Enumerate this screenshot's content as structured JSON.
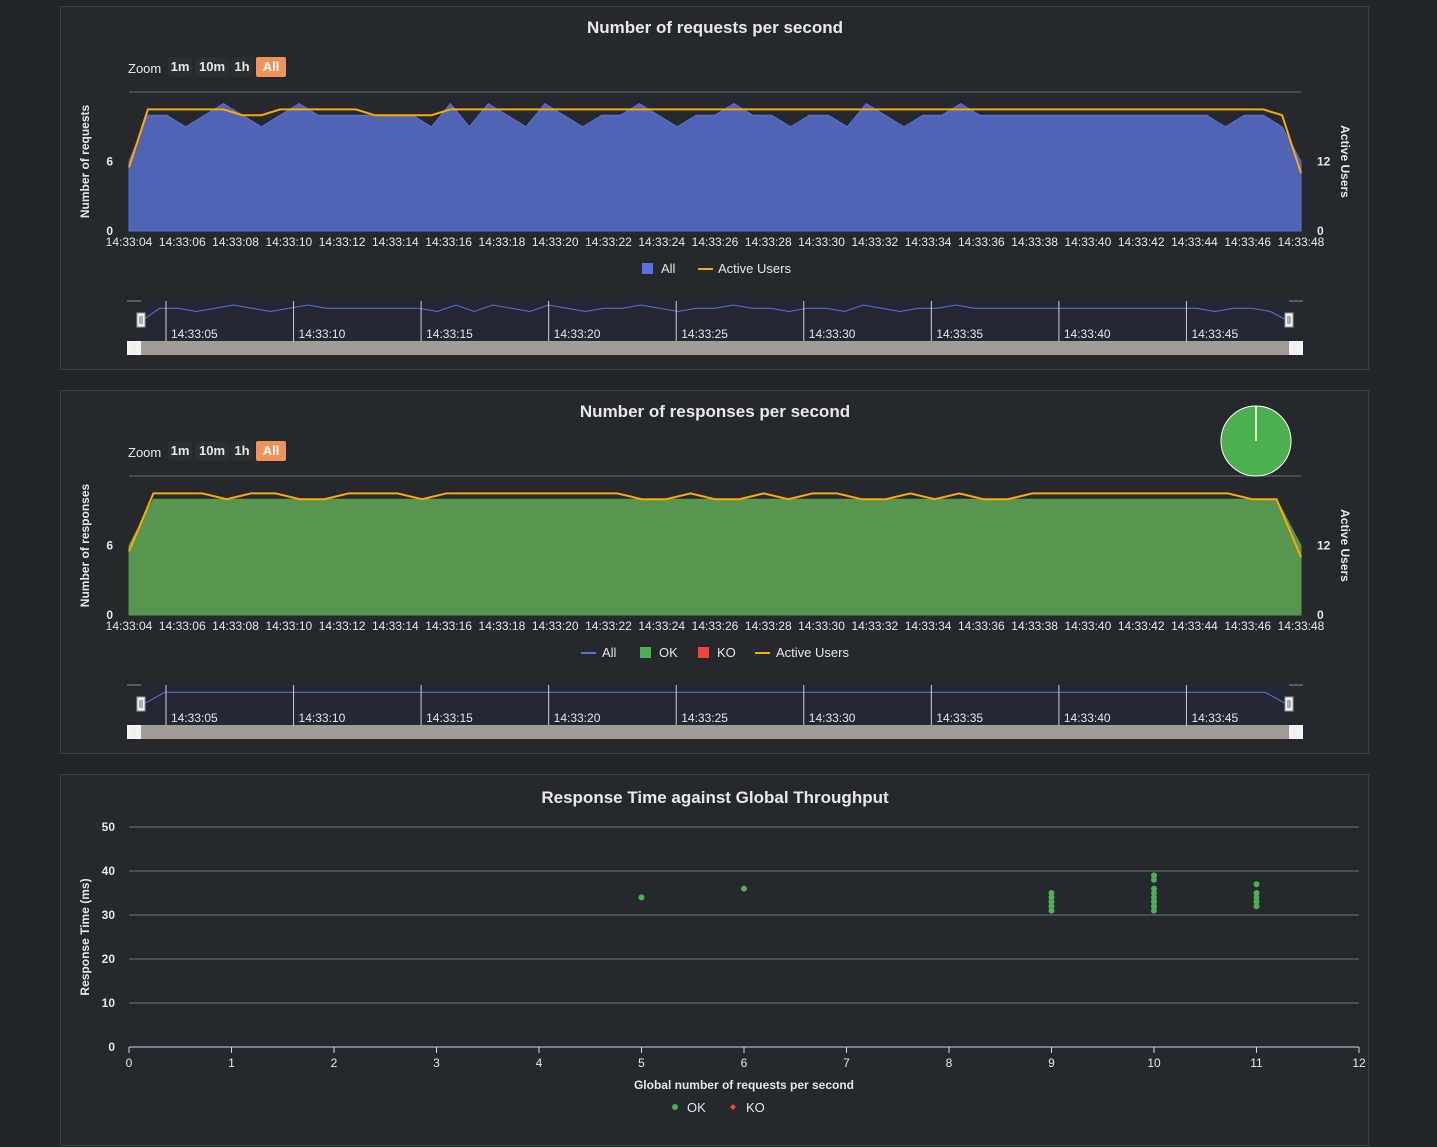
{
  "zoom": {
    "label": "Zoom",
    "buttons": [
      "1m",
      "10m",
      "1h",
      "All"
    ],
    "active": "All"
  },
  "time_ticks": [
    "14:33:04",
    "14:33:06",
    "14:33:08",
    "14:33:10",
    "14:33:12",
    "14:33:14",
    "14:33:16",
    "14:33:18",
    "14:33:20",
    "14:33:22",
    "14:33:24",
    "14:33:26",
    "14:33:28",
    "14:33:30",
    "14:33:32",
    "14:33:34",
    "14:33:36",
    "14:33:38",
    "14:33:40",
    "14:33:42",
    "14:33:44",
    "14:33:46",
    "14:33:48"
  ],
  "navigator_ticks": [
    "14:33:05",
    "14:33:10",
    "14:33:15",
    "14:33:20",
    "14:33:25",
    "14:33:30",
    "14:33:35",
    "14:33:40",
    "14:33:45"
  ],
  "colors": {
    "all": "#5d6fd8",
    "ok": "#4caf50",
    "ko": "#f44336",
    "active_users": "#ffa900",
    "area_all": "#5063b4",
    "area_ok": "#58964f"
  },
  "chart_data": [
    {
      "type": "area",
      "title": "Number of requests per second",
      "ylabel": "Number of requests",
      "y2label": "Active Users",
      "yticks": [
        "0",
        "6"
      ],
      "y2ticks": [
        "0",
        "12"
      ],
      "ylim": [
        0,
        12
      ],
      "y2lim": [
        0,
        24
      ],
      "x_start_seconds": 0,
      "x_step_seconds": 1,
      "series": [
        {
          "name": "All",
          "values": [
            6,
            10,
            10,
            9,
            10,
            11,
            10,
            9,
            10,
            11,
            10,
            10,
            10,
            10,
            10,
            10,
            9,
            11,
            9,
            11,
            10,
            9,
            11,
            10,
            9,
            10,
            10,
            11,
            10,
            9,
            10,
            10,
            11,
            10,
            10,
            9,
            10,
            10,
            9,
            11,
            10,
            9,
            10,
            10,
            11,
            10,
            10,
            10,
            10,
            10,
            10,
            10,
            10,
            10,
            10,
            10,
            10,
            10,
            9,
            10,
            10,
            9,
            6
          ]
        },
        {
          "name": "Active Users",
          "values": [
            11,
            21,
            21,
            21,
            21,
            21,
            20,
            20,
            21,
            21,
            21,
            21,
            21,
            20,
            20,
            20,
            20,
            21,
            21,
            21,
            21,
            21,
            21,
            21,
            21,
            21,
            21,
            21,
            21,
            21,
            21,
            21,
            21,
            21,
            21,
            21,
            21,
            21,
            21,
            21,
            21,
            21,
            21,
            21,
            21,
            21,
            21,
            21,
            21,
            21,
            21,
            21,
            21,
            21,
            21,
            21,
            21,
            21,
            21,
            21,
            21,
            20,
            10
          ]
        }
      ],
      "legend": [
        "All",
        "Active Users"
      ]
    },
    {
      "type": "area",
      "title": "Number of responses per second",
      "ylabel": "Number of responses",
      "y2label": "Active Users",
      "yticks": [
        "0",
        "6"
      ],
      "y2ticks": [
        "0",
        "12"
      ],
      "ylim": [
        0,
        12
      ],
      "y2lim": [
        0,
        24
      ],
      "series": [
        {
          "name": "All",
          "values": [
            6,
            10,
            10,
            10,
            10,
            10,
            10,
            10,
            10,
            10,
            10,
            10,
            10,
            10,
            10,
            10,
            10,
            10,
            10,
            10,
            10,
            10,
            10,
            10,
            10,
            10,
            10,
            10,
            10,
            10,
            10,
            10,
            10,
            10,
            10,
            10,
            10,
            10,
            10,
            10,
            10,
            10,
            10,
            10,
            10,
            10,
            10,
            10,
            6
          ]
        },
        {
          "name": "OK",
          "values": [
            6,
            10,
            10,
            10,
            10,
            10,
            10,
            10,
            10,
            10,
            10,
            10,
            10,
            10,
            10,
            10,
            10,
            10,
            10,
            10,
            10,
            10,
            10,
            10,
            10,
            10,
            10,
            10,
            10,
            10,
            10,
            10,
            10,
            10,
            10,
            10,
            10,
            10,
            10,
            10,
            10,
            10,
            10,
            10,
            10,
            10,
            10,
            10,
            6
          ]
        },
        {
          "name": "KO",
          "values": [
            0,
            0,
            0,
            0,
            0,
            0,
            0,
            0,
            0,
            0,
            0,
            0,
            0,
            0,
            0,
            0,
            0,
            0,
            0,
            0,
            0,
            0,
            0,
            0,
            0,
            0,
            0,
            0,
            0,
            0,
            0,
            0,
            0,
            0,
            0,
            0,
            0,
            0,
            0,
            0,
            0,
            0,
            0,
            0,
            0,
            0,
            0,
            0,
            0
          ]
        },
        {
          "name": "Active Users",
          "values": [
            11,
            21,
            21,
            21,
            20,
            21,
            21,
            20,
            20,
            21,
            21,
            21,
            20,
            21,
            21,
            21,
            21,
            21,
            21,
            21,
            21,
            20,
            20,
            21,
            20,
            20,
            21,
            20,
            21,
            21,
            20,
            20,
            21,
            20,
            21,
            20,
            20,
            21,
            21,
            21,
            21,
            21,
            21,
            21,
            21,
            21,
            20,
            20,
            10
          ]
        }
      ],
      "legend": [
        "All",
        "OK",
        "KO",
        "Active Users"
      ],
      "pie": {
        "ok_fraction": 1.0,
        "ko_fraction": 0.0
      }
    },
    {
      "type": "scatter",
      "title": "Response Time against Global Throughput",
      "xlabel": "Global number of requests per second",
      "ylabel": "Response Time (ms)",
      "xlim": [
        0,
        12
      ],
      "ylim": [
        0,
        50
      ],
      "xticks": [
        "0",
        "1",
        "2",
        "3",
        "4",
        "5",
        "6",
        "7",
        "8",
        "9",
        "10",
        "11",
        "12"
      ],
      "yticks": [
        "0",
        "10",
        "20",
        "30",
        "40",
        "50"
      ],
      "series": [
        {
          "name": "OK",
          "points": [
            [
              5,
              34
            ],
            [
              6,
              36
            ],
            [
              9,
              31
            ],
            [
              9,
              32
            ],
            [
              9,
              33
            ],
            [
              9,
              34
            ],
            [
              9,
              35
            ],
            [
              10,
              31
            ],
            [
              10,
              32
            ],
            [
              10,
              33
            ],
            [
              10,
              34
            ],
            [
              10,
              35
            ],
            [
              10,
              36
            ],
            [
              10,
              38
            ],
            [
              10,
              39
            ],
            [
              11,
              32
            ],
            [
              11,
              33
            ],
            [
              11,
              34
            ],
            [
              11,
              35
            ],
            [
              11,
              37
            ]
          ]
        },
        {
          "name": "KO",
          "points": []
        }
      ],
      "legend": [
        "OK",
        "KO"
      ]
    }
  ]
}
